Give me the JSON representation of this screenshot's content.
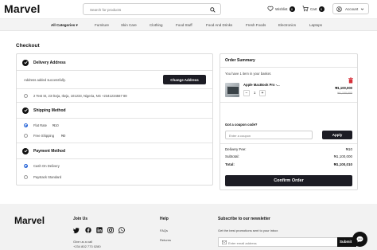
{
  "header": {
    "logo": "Marvel",
    "search_placeholder": "Search for products",
    "wishlist_label": "Wishlist",
    "wishlist_count": "0",
    "cart_label": "Cart",
    "cart_count": "0",
    "account_label": "Account"
  },
  "categories": {
    "all_label": "All Categories",
    "items": [
      "Furniture",
      "Skin Care",
      "Clothing",
      "Food Stuff",
      "Food And Drinks",
      "Fresh Foods",
      "Electronics",
      "Laptops"
    ]
  },
  "checkout": {
    "title": "Checkout",
    "delivery": {
      "heading": "Delivery Address",
      "success_msg": "Address added successfully.",
      "change_button": "Change Address",
      "address": "2 Test St, 23 Ikeja, Ikeja, 101233, Nigeria, NG +2341234567 89"
    },
    "shipping": {
      "heading": "Shipping Method",
      "options": [
        {
          "label": "Flat Rate",
          "price": "₦10",
          "selected": true
        },
        {
          "label": "Free Shipping",
          "price": "₦0",
          "selected": false
        }
      ]
    },
    "payment": {
      "heading": "Payment Method",
      "options": [
        {
          "label": "Cash On Delivery",
          "selected": true
        },
        {
          "label": "Paystack Standard",
          "selected": false
        }
      ]
    }
  },
  "summary": {
    "heading": "Order Summary",
    "basket_note": "You have 1 item in your basket.",
    "product": {
      "name": "Apple MacBook Pro -...",
      "price": "₦1,100,000",
      "old_price": "₦1,100,000",
      "quantity": "1"
    },
    "coupon_label": "Got a coupon code?",
    "coupon_placeholder": "Enter a coupon",
    "apply_button": "Apply",
    "delivery_fee_label": "Delivery Fee:",
    "delivery_fee_value": "₦10",
    "subtotal_label": "Subtotal:",
    "subtotal_value": "₦1,100,000",
    "total_label": "Total:",
    "total_value": "₦1,100,010",
    "confirm_button": "Confirm Order"
  },
  "footer": {
    "logo": "Marvel",
    "join_heading": "Join Us",
    "call_label": "Give us a call",
    "phone": "+234 802 773 0280",
    "help_heading": "Help",
    "help_links": [
      "FAQs",
      "Returns"
    ],
    "newsletter_heading": "Subscribe to our newsletter",
    "newsletter_desc": "Get the best promotions sent to your inbox",
    "email_placeholder": "Enter email address",
    "submit_label": "Submit"
  }
}
